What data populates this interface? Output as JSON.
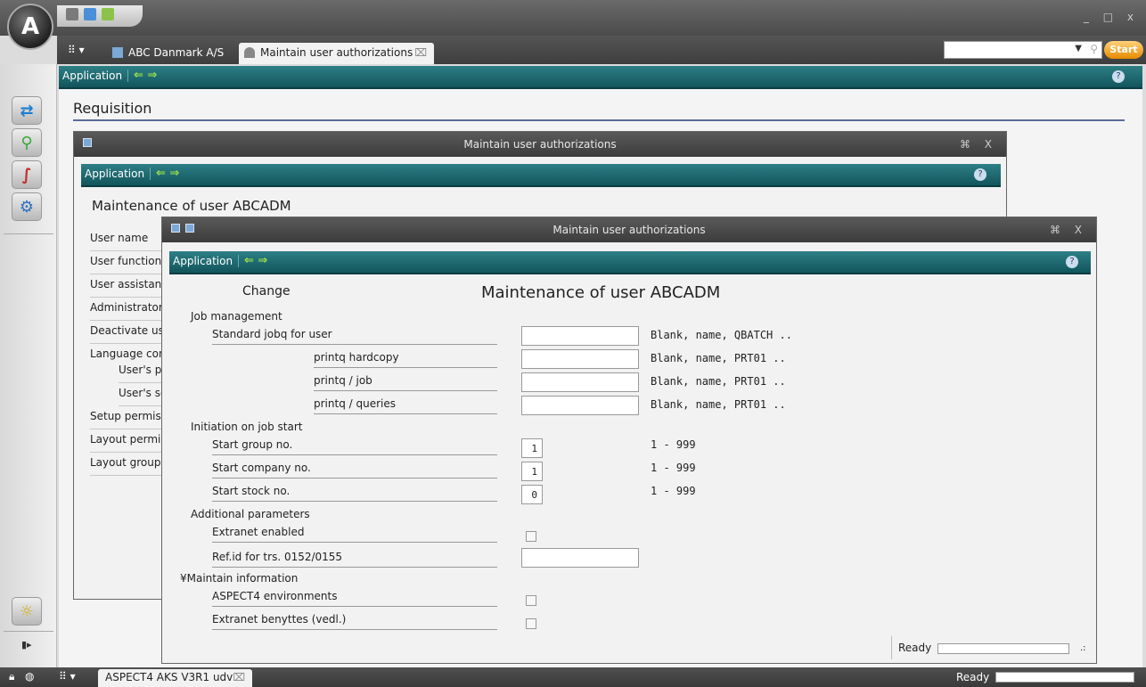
{
  "titlebar": {
    "logo_letter": "A",
    "window_controls": "_ □ x"
  },
  "tabbar": {
    "menu_glyph": "⠿ ▾",
    "tabs": [
      {
        "label": "ABC Danmark A/S",
        "close": ""
      },
      {
        "label": "Maintain user authorizations",
        "close": "⌧"
      }
    ],
    "search_placeholder": "",
    "start_label": "Start"
  },
  "main": {
    "toolbar_label": "Application",
    "arrows": "⇐ ⇒",
    "heading": "Requisition"
  },
  "win1": {
    "title": "Maintain user authorizations",
    "toolbar_label": "Application",
    "heading": "Maintenance of user ABCADM",
    "controls": "⌘ X",
    "nav": [
      "User name",
      "User function",
      "User assistant",
      "Administrator",
      "Deactivate user",
      "Language con",
      "User's pr",
      "User's se",
      "Setup permiss",
      "Layout permis",
      "Layout groups"
    ]
  },
  "win2": {
    "title": "Maintain user authorizations",
    "toolbar_label": "Application",
    "mode": "Change",
    "heading": "Maintenance of user ABCADM",
    "controls": "⌘ X",
    "sections": {
      "job_management": "Job management",
      "initiation": "Initiation on job start",
      "additional": "Additional parameters",
      "maintain": "¥Maintain information"
    },
    "fields": {
      "std_jobq": {
        "label": "Standard jobq for user",
        "value": "",
        "hint": "Blank, name, QBATCH .."
      },
      "printq_hardcopy": {
        "label": "printq hardcopy",
        "value": "",
        "hint": "Blank, name, PRT01 .."
      },
      "printq_job": {
        "label": "printq / job",
        "value": "",
        "hint": "Blank, name, PRT01 .."
      },
      "printq_queries": {
        "label": "printq / queries",
        "value": "",
        "hint": "Blank, name, PRT01 .."
      },
      "start_group": {
        "label": "Start group no.",
        "value": "1",
        "hint": "1 - 999"
      },
      "start_company": {
        "label": "Start company no.",
        "value": "1",
        "hint": "1 - 999"
      },
      "start_stock": {
        "label": "Start stock no.",
        "value": "0",
        "hint": "1 - 999"
      },
      "extranet_enabled": {
        "label": "Extranet enabled",
        "checked": false
      },
      "ref_id": {
        "label": "Ref.id for trs.  0152/0155",
        "value": ""
      },
      "aspect4_env": {
        "label": "ASPECT4 environments",
        "checked": false
      },
      "extranet_benyttes": {
        "label": "Extranet benyttes (vedl.)",
        "checked": false
      }
    },
    "status": "Ready"
  },
  "statusbar": {
    "session_tab": "ASPECT4 AKS V3R1 udv",
    "status": "Ready"
  },
  "colors": {
    "toolbar": "#1d6a71",
    "accent_green": "#9ee34a",
    "start_button": "#f0a020"
  }
}
